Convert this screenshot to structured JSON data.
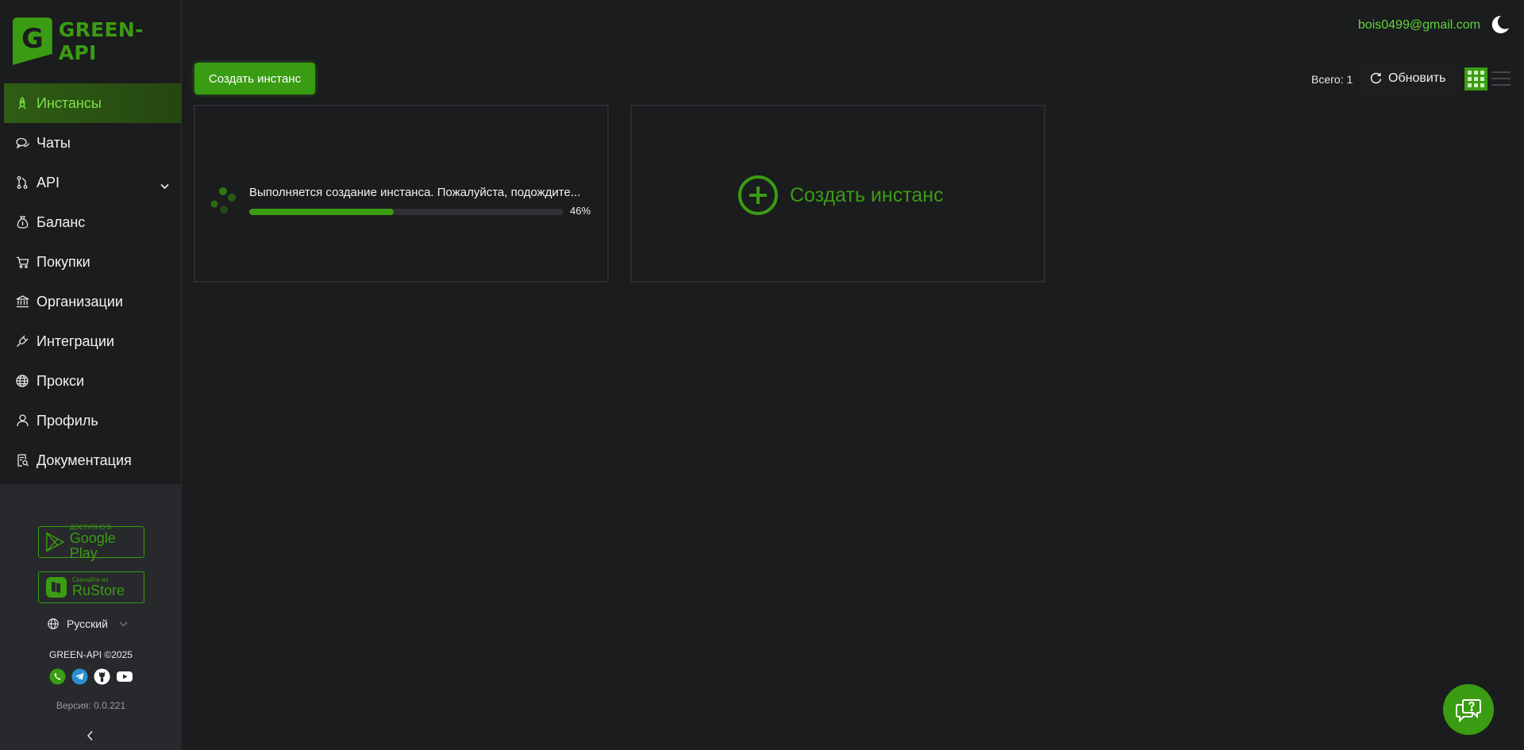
{
  "brand": {
    "name": "GREEN-API",
    "accent": "#3a9c12"
  },
  "sidebar": {
    "items": [
      {
        "label": "Инстансы",
        "icon": "rocket-icon",
        "active": true
      },
      {
        "label": "Чаты",
        "icon": "chat-icon"
      },
      {
        "label": "API",
        "icon": "api-icon"
      },
      {
        "label": "Баланс",
        "icon": "money-bag-icon"
      },
      {
        "label": "Покупки",
        "icon": "cart-icon"
      },
      {
        "label": "Организации",
        "icon": "bank-icon"
      },
      {
        "label": "Интеграции",
        "icon": "plug-icon"
      },
      {
        "label": "Прокси",
        "icon": "globe-icon"
      },
      {
        "label": "Профиль",
        "icon": "user-icon"
      },
      {
        "label": "Документация",
        "icon": "document-search-icon"
      }
    ],
    "google_play": {
      "small": "ДОСТУПНО В",
      "big": "Google Play"
    },
    "rustore": {
      "small": "Скачайте из",
      "big": "RuStore"
    },
    "language": "Русский",
    "copyright": "GREEN-API ©2025",
    "version": "Версия: 0.0.221"
  },
  "header": {
    "email": "bois0499@gmail.com"
  },
  "toolbar": {
    "create_label": "Создать инстанс",
    "total_label": "Всего: 1",
    "refresh_label": "Обновить"
  },
  "instance_card": {
    "status_text": "Выполняется создание инстанса. Пожалуйста, подождите...",
    "progress_percent": 46,
    "progress_label": "46%"
  },
  "create_card": {
    "label": "Создать инстанс"
  }
}
